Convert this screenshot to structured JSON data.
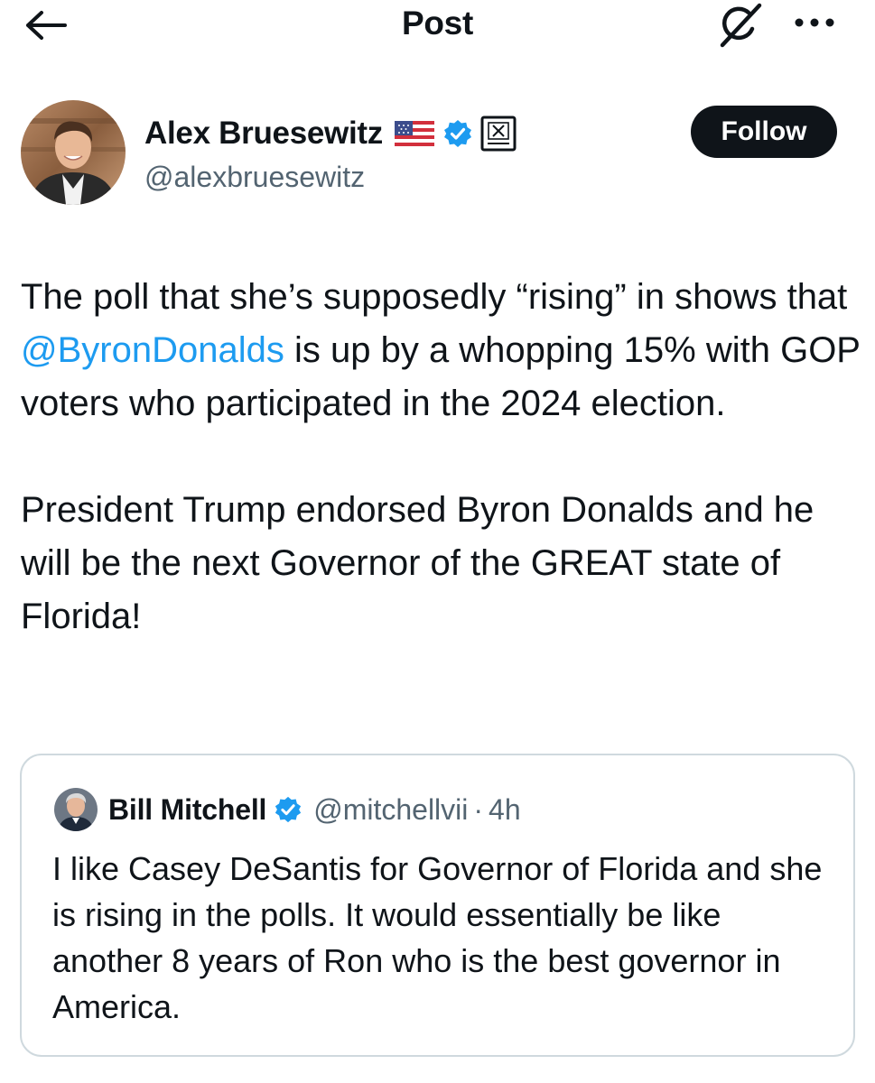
{
  "header": {
    "title": "Post",
    "back_icon": "arrow-left-icon",
    "grok_icon": "grok-icon",
    "more_icon": "more-horizontal-icon"
  },
  "author": {
    "name": "Alex Bruesewitz",
    "handle": "@alexbruesewitz",
    "flag_icon": "us-flag-icon",
    "verified_icon": "verified-badge-icon",
    "affiliate_icon": "affiliate-badge-icon",
    "follow_label": "Follow"
  },
  "post": {
    "line1_pre": "The poll that she’s supposedly “rising” in shows that ",
    "mention": "@ByronDonalds",
    "line1_post": " is up by a whopping 15% with GOP voters who participated in the 2024 election.",
    "paragraph2": "President Trump endorsed Byron Donalds and he will be the next Governor of the GREAT state of Florida!"
  },
  "quote": {
    "name": "Bill Mitchell",
    "handle": "@mitchellvii",
    "separator": "·",
    "time": "4h",
    "text": "I like Casey DeSantis for Governor of Florida and she is rising in the polls.  It would essentially be like another 8 years of Ron who is the best governor in America."
  },
  "colors": {
    "text": "#0f1419",
    "secondary": "#536471",
    "link": "#1d9bf0",
    "border": "#cfd9de"
  }
}
